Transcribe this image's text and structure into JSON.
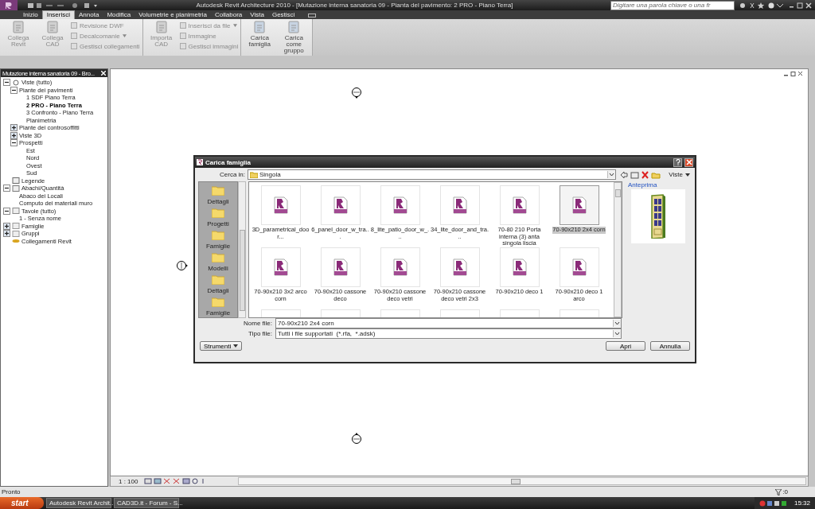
{
  "window": {
    "title": "Autodesk Revit Architecture 2010 - [Mutazione interna sanatoria 09 - Pianta del pavimento: 2 PRO - Piano Terra]"
  },
  "search": {
    "placeholder": "Digitare una parola chiave o una fr"
  },
  "ribbon_tabs": [
    {
      "label": "Inizio",
      "selected": false
    },
    {
      "label": "Inserisci",
      "selected": true
    },
    {
      "label": "Annota",
      "selected": false
    },
    {
      "label": "Modifica",
      "selected": false
    },
    {
      "label": "Volumetrie e planimetria",
      "selected": false
    },
    {
      "label": "Collabora",
      "selected": false
    },
    {
      "label": "Vista",
      "selected": false
    },
    {
      "label": "Gestisci",
      "selected": false
    }
  ],
  "ribbon_panels": [
    {
      "buttons": [
        {
          "label": "Collega Revit",
          "kind": "large",
          "disabled": true
        },
        {
          "label": "Collega CAD",
          "kind": "large",
          "disabled": true
        },
        {
          "label": "Revisione DWF",
          "kind": "small",
          "disabled": true
        },
        {
          "label": "Decalcomanie",
          "kind": "dropdown",
          "disabled": true
        },
        {
          "label": "Gestisci collegamenti",
          "kind": "small",
          "disabled": true
        }
      ]
    },
    {
      "buttons": [
        {
          "label": "Importa CAD",
          "kind": "large",
          "disabled": true
        },
        {
          "label": "Inserisci da file",
          "kind": "dropdown",
          "disabled": true
        },
        {
          "label": "Immagine",
          "kind": "small",
          "disabled": true
        },
        {
          "label": "Gestisci immagini",
          "kind": "small",
          "disabled": true
        }
      ]
    },
    {
      "buttons": [
        {
          "label": "Carica famiglia",
          "kind": "large",
          "disabled": false
        },
        {
          "label": "Carica come gruppo",
          "kind": "large",
          "disabled": false
        }
      ]
    }
  ],
  "project_browser": {
    "title": "Mutazione interna sanatoria 09 - Bro...",
    "tree": [
      {
        "label": "Viste (tutto)",
        "kind": "views",
        "expanded": true,
        "selected": false,
        "children": [
          {
            "label": "Piante dei pavimenti",
            "expanded": true,
            "selected": false,
            "children": [
              {
                "label": "1 SDF Piano Terra",
                "selected": false
              },
              {
                "label": "2 PRO - Piano Terra",
                "selected": true
              },
              {
                "label": "3 Confronto - Piano Terra",
                "selected": false
              },
              {
                "label": "Planimetria",
                "selected": false
              }
            ]
          },
          {
            "label": "Piante dei controsoffitti",
            "expanded": false,
            "selected": false
          },
          {
            "label": "Viste 3D",
            "expanded": false,
            "selected": false
          },
          {
            "label": "Prospetti",
            "expanded": true,
            "selected": false,
            "children": [
              {
                "label": "Est",
                "selected": false
              },
              {
                "label": "Nord",
                "selected": false
              },
              {
                "label": "Ovest",
                "selected": false
              },
              {
                "label": "Sud",
                "selected": false
              }
            ]
          }
        ]
      },
      {
        "label": "Legende",
        "kind": "legends",
        "selected": false
      },
      {
        "label": "Abachi/Quantità",
        "kind": "schedules",
        "expanded": true,
        "selected": false,
        "children": [
          {
            "label": "Abaco dei Locali",
            "selected": false
          },
          {
            "label": "Computo dei materiali muro",
            "selected": false
          }
        ]
      },
      {
        "label": "Tavole (tutto)",
        "kind": "sheets",
        "expanded": true,
        "selected": false,
        "children": [
          {
            "label": "1 - Senza nome",
            "selected": false
          }
        ]
      },
      {
        "label": "Famiglie",
        "kind": "families",
        "expanded": false,
        "selected": false
      },
      {
        "label": "Gruppi",
        "kind": "groups",
        "expanded": false,
        "selected": false
      },
      {
        "label": "Collegamenti Revit",
        "kind": "links",
        "selected": false
      }
    ]
  },
  "dialog": {
    "title": "Carica famiglia",
    "look_in_label": "Cerca in:",
    "look_in": "Singola",
    "views_label": "Viste",
    "preview_label": "Anteprima",
    "places": [
      "Dettagli",
      "Progetti",
      "Famiglie",
      "Modelli",
      "Dettagli",
      "Famiglie"
    ],
    "files": [
      {
        "name": "3D_parametrical_door...",
        "selected": false
      },
      {
        "name": "6_panel_door_w_tra...",
        "selected": false
      },
      {
        "name": "8_lite_patio_door_w_...",
        "selected": false
      },
      {
        "name": "34_lite_door_and_tra...",
        "selected": false
      },
      {
        "name": "70-80 210 Porta interna (3) anta singola liscia",
        "selected": false
      },
      {
        "name": "70-90x210 2x4 corn",
        "selected": true
      },
      {
        "name": "70-90x210 3x2 arco corn",
        "selected": false
      },
      {
        "name": "70-90x210 cassone deco",
        "selected": false
      },
      {
        "name": "70-90x210 cassone deco vetri",
        "selected": false
      },
      {
        "name": "70-90x210 cassone deco vetri 2x3",
        "selected": false
      },
      {
        "name": "70-90x210 deco 1",
        "selected": false
      },
      {
        "name": "70-90x210 deco 1 arco",
        "selected": false
      }
    ],
    "file_name_label": "Nome file:",
    "file_name": "70-90x210 2x4 corn",
    "file_type_label": "Tipo file:",
    "file_type": "Tutti i file supportati  (*.rfa,  *.adsk)",
    "tools_button": "Strumenti",
    "buttons": [
      "Apri",
      "Annulla"
    ]
  },
  "view_bar": {
    "scale": "1 : 100"
  },
  "status_bar": {
    "text": "Pronto",
    "filter_count": ":0"
  },
  "taskbar": {
    "start": "start",
    "tasks": [
      "Autodesk Revit Archit...",
      "CAD3D.it - Forum - S..."
    ],
    "clock": "15:32"
  }
}
